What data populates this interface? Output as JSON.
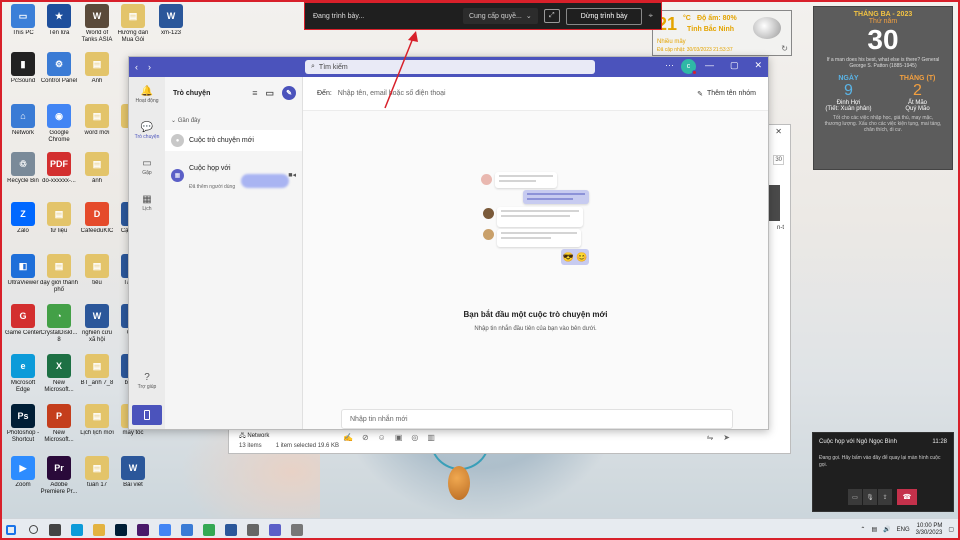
{
  "desktop": {
    "icons": [
      {
        "label": "This PC",
        "color": "#3b7fd8",
        "glyph": "▭"
      },
      {
        "label": "Tên lửa",
        "color": "#1e4f9c",
        "glyph": "★"
      },
      {
        "label": "World of Tanks ASIA",
        "color": "#5a4a3a",
        "glyph": "W"
      },
      {
        "label": "Hướng dẫn Mua Gói",
        "color": "#e3c46a",
        "glyph": "▤"
      },
      {
        "label": "xm-123",
        "color": "#2b579a",
        "glyph": "W"
      },
      {
        "label": "PcSound",
        "color": "#222",
        "glyph": "▮"
      },
      {
        "label": "Control Panel",
        "color": "#3a7bd5",
        "glyph": "⚙"
      },
      {
        "label": "Anh",
        "color": "#e3c46a",
        "glyph": "▤"
      },
      {
        "label": "Network",
        "color": "#3a7bd5",
        "glyph": "⌂"
      },
      {
        "label": "Google Chrome",
        "color": "#4285f4",
        "glyph": "◉"
      },
      {
        "label": "word mới",
        "color": "#e3c46a",
        "glyph": "▤"
      },
      {
        "label": "File",
        "color": "#e3c46a",
        "glyph": "▤"
      },
      {
        "label": "Recycle Bin",
        "color": "#7a8a99",
        "glyph": "♲"
      },
      {
        "label": "do-xxxxxx-...",
        "color": "#d32f2f",
        "glyph": "PDF"
      },
      {
        "label": "ảnh",
        "color": "#e3c46a",
        "glyph": "▤"
      },
      {
        "label": "Zalo",
        "color": "#0068ff",
        "glyph": "Z"
      },
      {
        "label": "tư liệu",
        "color": "#e3c46a",
        "glyph": "▤"
      },
      {
        "label": "CafeeduKIC",
        "color": "#e54b2b",
        "glyph": "D"
      },
      {
        "label": "Cập nhật",
        "color": "#2b579a",
        "glyph": "W"
      },
      {
        "label": "UltraViewer",
        "color": "#1e6fd9",
        "glyph": "◧"
      },
      {
        "label": "đạy giới thành phố",
        "color": "#e3c46a",
        "glyph": "▤"
      },
      {
        "label": "tiểu",
        "color": "#e3c46a",
        "glyph": "▤"
      },
      {
        "label": "Tài liệu",
        "color": "#2b579a",
        "glyph": "W"
      },
      {
        "label": "Game Center",
        "color": "#d32f2f",
        "glyph": "G"
      },
      {
        "label": "CrystalDiskI... 8",
        "color": "#43a047",
        "glyph": "◔"
      },
      {
        "label": "nghiên cứu xã hội",
        "color": "#2b579a",
        "glyph": "W"
      },
      {
        "label": "Giấy",
        "color": "#2b579a",
        "glyph": "W"
      },
      {
        "label": "Microsoft Edge",
        "color": "#0c9bd9",
        "glyph": "e"
      },
      {
        "label": "New Microsoft...",
        "color": "#1d7044",
        "glyph": "X"
      },
      {
        "label": "BT_anh 7_8",
        "color": "#e3c46a",
        "glyph": "▤"
      },
      {
        "label": "bt nha",
        "color": "#2b579a",
        "glyph": "W"
      },
      {
        "label": "Photoshop - Shortcut",
        "color": "#001e36",
        "glyph": "Ps"
      },
      {
        "label": "New Microsoft...",
        "color": "#c43e1c",
        "glyph": "P"
      },
      {
        "label": "Lịch lịch mới",
        "color": "#e3c46a",
        "glyph": "▤"
      },
      {
        "label": "may tốc",
        "color": "#e3c46a",
        "glyph": "▤"
      },
      {
        "label": "Zoom",
        "color": "#2d8cff",
        "glyph": "▶"
      },
      {
        "label": "Adobe Premiere Pr...",
        "color": "#2a0a3a",
        "glyph": "Pr"
      },
      {
        "label": "tuần 17",
        "color": "#e3c46a",
        "glyph": "▤"
      },
      {
        "label": "Bài viết",
        "color": "#2b579a",
        "glyph": "W"
      }
    ]
  },
  "presenting_bar": {
    "status": "Đang trình bày...",
    "control_dropdown": "Cung cấp quyề...",
    "stop_button": "Dừng trình bày"
  },
  "weather": {
    "temp": "21",
    "unit": "°C",
    "humidity": "Độ ẩm: 80%",
    "province": "Tỉnh Bắc Ninh",
    "condition": "Nhiều mây",
    "updated": "Đã cập nhật: 30/03/2023 21:53:37"
  },
  "calendar": {
    "month_year": "THÁNG BA - 2023",
    "weekday": "Thứ năm",
    "day": "30",
    "quote": "If a man does his best, what else is there? General George S. Patton (1885-1945)",
    "solar_label": "NGÀY",
    "solar_day": "9",
    "solar_sub": "Đinh Hợi",
    "solar_sub2": "(Tiết: Xuân phân)",
    "lunar_label": "THÁNG (T)",
    "lunar_day": "2",
    "lunar_sub": "Ất Mão",
    "lunar_sub2": "Quý Mão",
    "footer": "Tốt cho các việc nhập học, giá thú, may mặc, thương lượng. Xấu cho các việc kiện tụng, mai táng, chăn thích, di cư."
  },
  "teams": {
    "search_placeholder": "Tìm kiếm",
    "rail": [
      {
        "label": "Hoạt động",
        "icon": "🔔"
      },
      {
        "label": "Trò chuyện",
        "icon": "💬"
      },
      {
        "label": "Gặp",
        "icon": "📹"
      },
      {
        "label": "Lịch",
        "icon": "📅"
      }
    ],
    "help_label": "Trợ giúp",
    "list_title": "Trò chuyện",
    "section": "Gần đây",
    "chats": [
      {
        "title": "Cuộc trò chuyện mới",
        "sub": ""
      },
      {
        "title": "Cuộc họp với",
        "sub": "Đã thêm người dùng"
      }
    ],
    "to_label": "Đến:",
    "to_placeholder": "Nhập tên, email hoặc số điện thoại",
    "add_people": "Thêm tên nhóm",
    "empty_title": "Bạn bắt đầu một cuộc trò chuyện mới",
    "empty_sub": "Nhập tin nhắn đầu tiên của bạn vào bên dưới.",
    "compose_placeholder": "Nhập tin nhắn mới"
  },
  "explorer": {
    "network": "Network",
    "items": "13 items",
    "selected": "1 item selected  19.6 KB",
    "num": "30",
    "label_t": "n-t"
  },
  "notification": {
    "title": "Cuộc họp với Ngô Ngọc Bình",
    "time": "11:28",
    "body": "Đang gọi. Hãy bấm vào đây để quay lại màn hình cuộc gọi."
  },
  "taskbar": {
    "lang": "ENG",
    "time": "10:00 PM",
    "date": "3/30/2023",
    "apps": [
      {
        "name": "start",
        "color": "#1a73e8"
      },
      {
        "name": "search",
        "color": "#444"
      },
      {
        "name": "task-view",
        "color": "#444"
      },
      {
        "name": "edge",
        "color": "#0c9bd9"
      },
      {
        "name": "file-explorer",
        "color": "#e3b341"
      },
      {
        "name": "photoshop",
        "color": "#001e36"
      },
      {
        "name": "premiere",
        "color": "#4a1a6a"
      },
      {
        "name": "chrome",
        "color": "#4285f4"
      },
      {
        "name": "snipping",
        "color": "#3a7bd5"
      },
      {
        "name": "chrome-2",
        "color": "#34a853"
      },
      {
        "name": "word",
        "color": "#2b579a"
      },
      {
        "name": "app-1",
        "color": "#666"
      },
      {
        "name": "teams",
        "color": "#5b5fc7"
      },
      {
        "name": "app-2",
        "color": "#777"
      }
    ]
  }
}
